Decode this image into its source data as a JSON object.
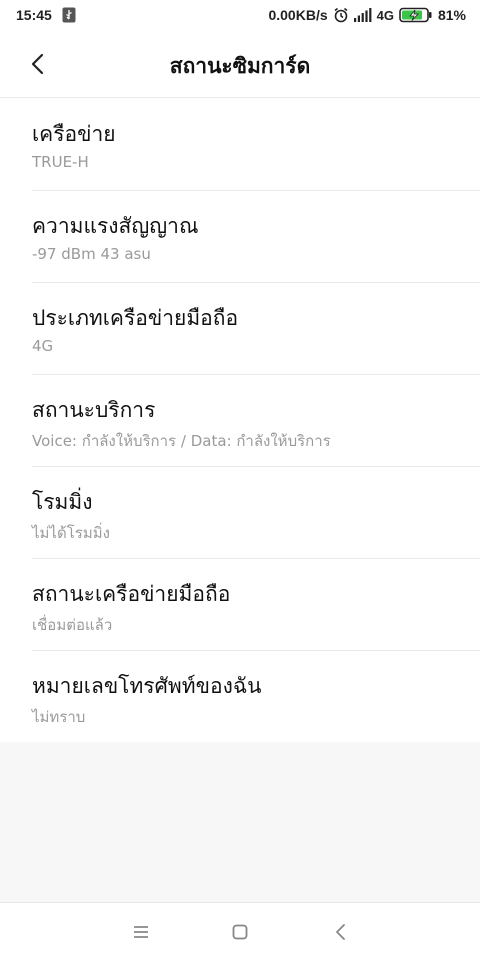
{
  "status_bar": {
    "time": "15:45",
    "net_speed": "0.00KB/s",
    "network_type": "4G",
    "battery": "81%"
  },
  "header": {
    "title": "สถานะซิมการ์ด"
  },
  "items": [
    {
      "label": "เครือข่าย",
      "value": "TRUE-H"
    },
    {
      "label": "ความแรงสัญญาณ",
      "value": "-97 dBm 43 asu"
    },
    {
      "label": "ประเภทเครือข่ายมือถือ",
      "value": "4G"
    },
    {
      "label": "สถานะบริการ",
      "value": "Voice: กำลังให้บริการ / Data: กำลังให้บริการ"
    },
    {
      "label": "โรมมิ่ง",
      "value": "ไม่ได้โรมมิ่ง"
    },
    {
      "label": "สถานะเครือข่ายมือถือ",
      "value": "เชื่อมต่อแล้ว"
    },
    {
      "label": "หมายเลขโทรศัพท์ของฉัน",
      "value": "ไม่ทราบ"
    }
  ],
  "icons": {
    "usb": "usb-icon",
    "alarm": "alarm-icon",
    "signal": "signal-icon",
    "battery": "battery-charging-icon",
    "back": "chevron-left-icon",
    "nav_menu": "menu-icon",
    "nav_home": "home-square-icon",
    "nav_back": "back-triangle-icon"
  },
  "colors": {
    "battery_fill": "#3cc44a",
    "secondary_text": "#9a9a9a",
    "background": "#f7f7f7"
  }
}
